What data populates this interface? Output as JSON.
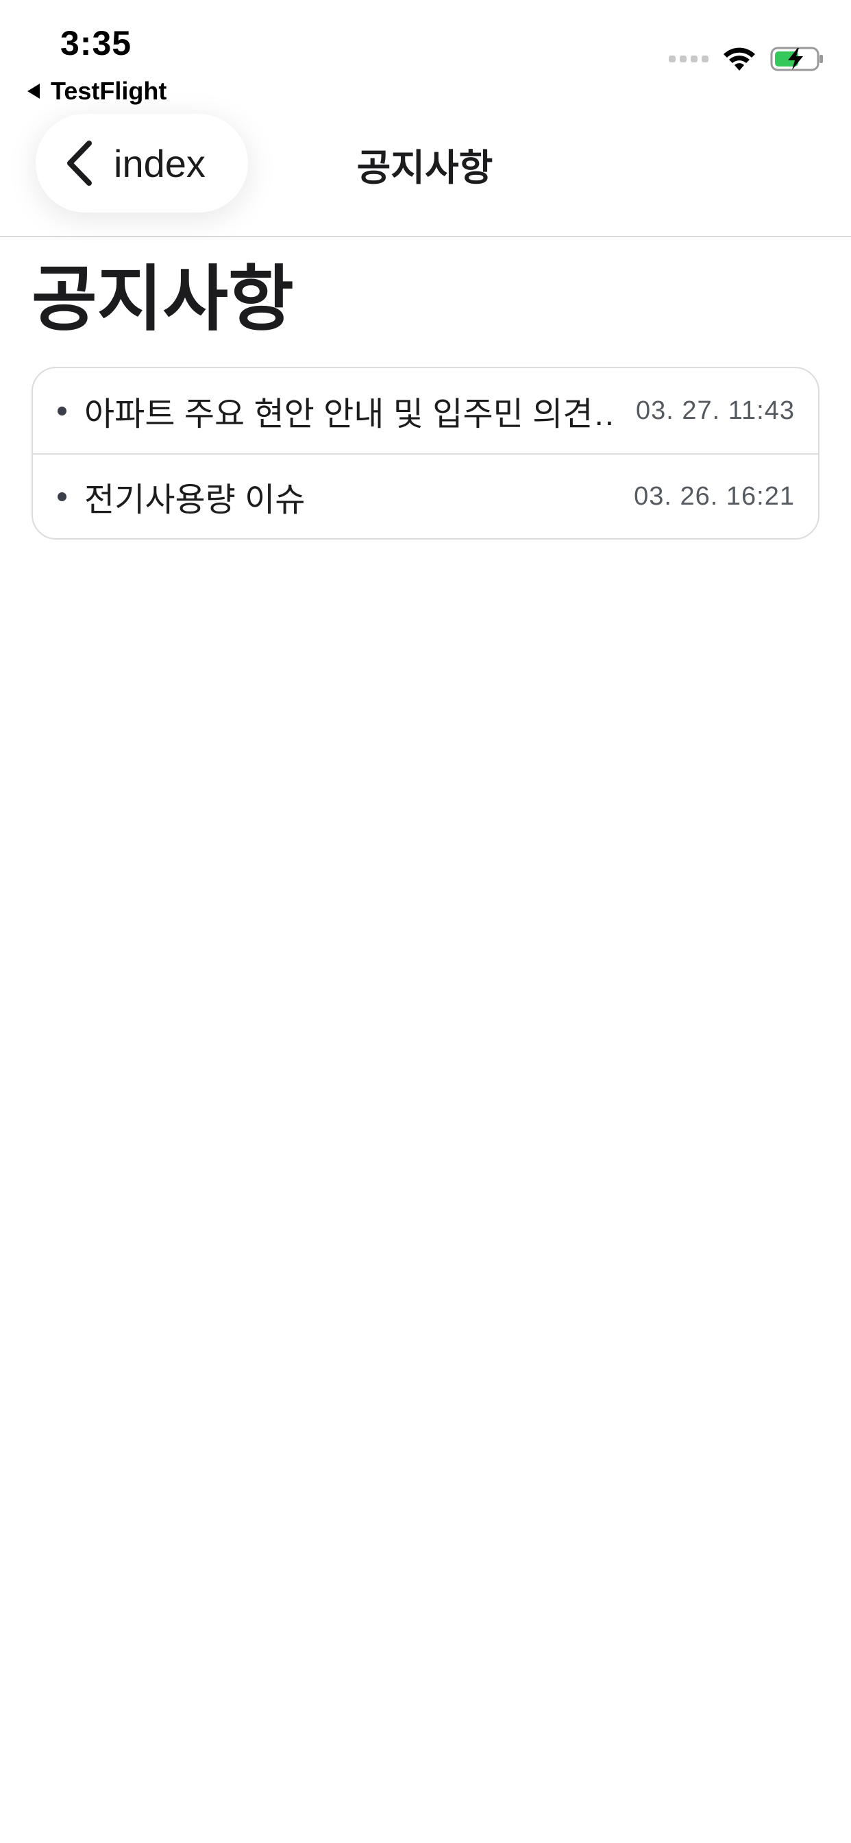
{
  "status_bar": {
    "time": "3:35",
    "back_app_label": "TestFlight",
    "battery_color": "#34c759"
  },
  "nav": {
    "back_label": "index",
    "title": "공지사항"
  },
  "page": {
    "title": "공지사항"
  },
  "notices": [
    {
      "title": "아파트 주요 현안 안내 및 입주민 의견…",
      "date": "03. 27. 11:43"
    },
    {
      "title": "전기사용량 이슈",
      "date": "03. 26. 16:21"
    }
  ]
}
